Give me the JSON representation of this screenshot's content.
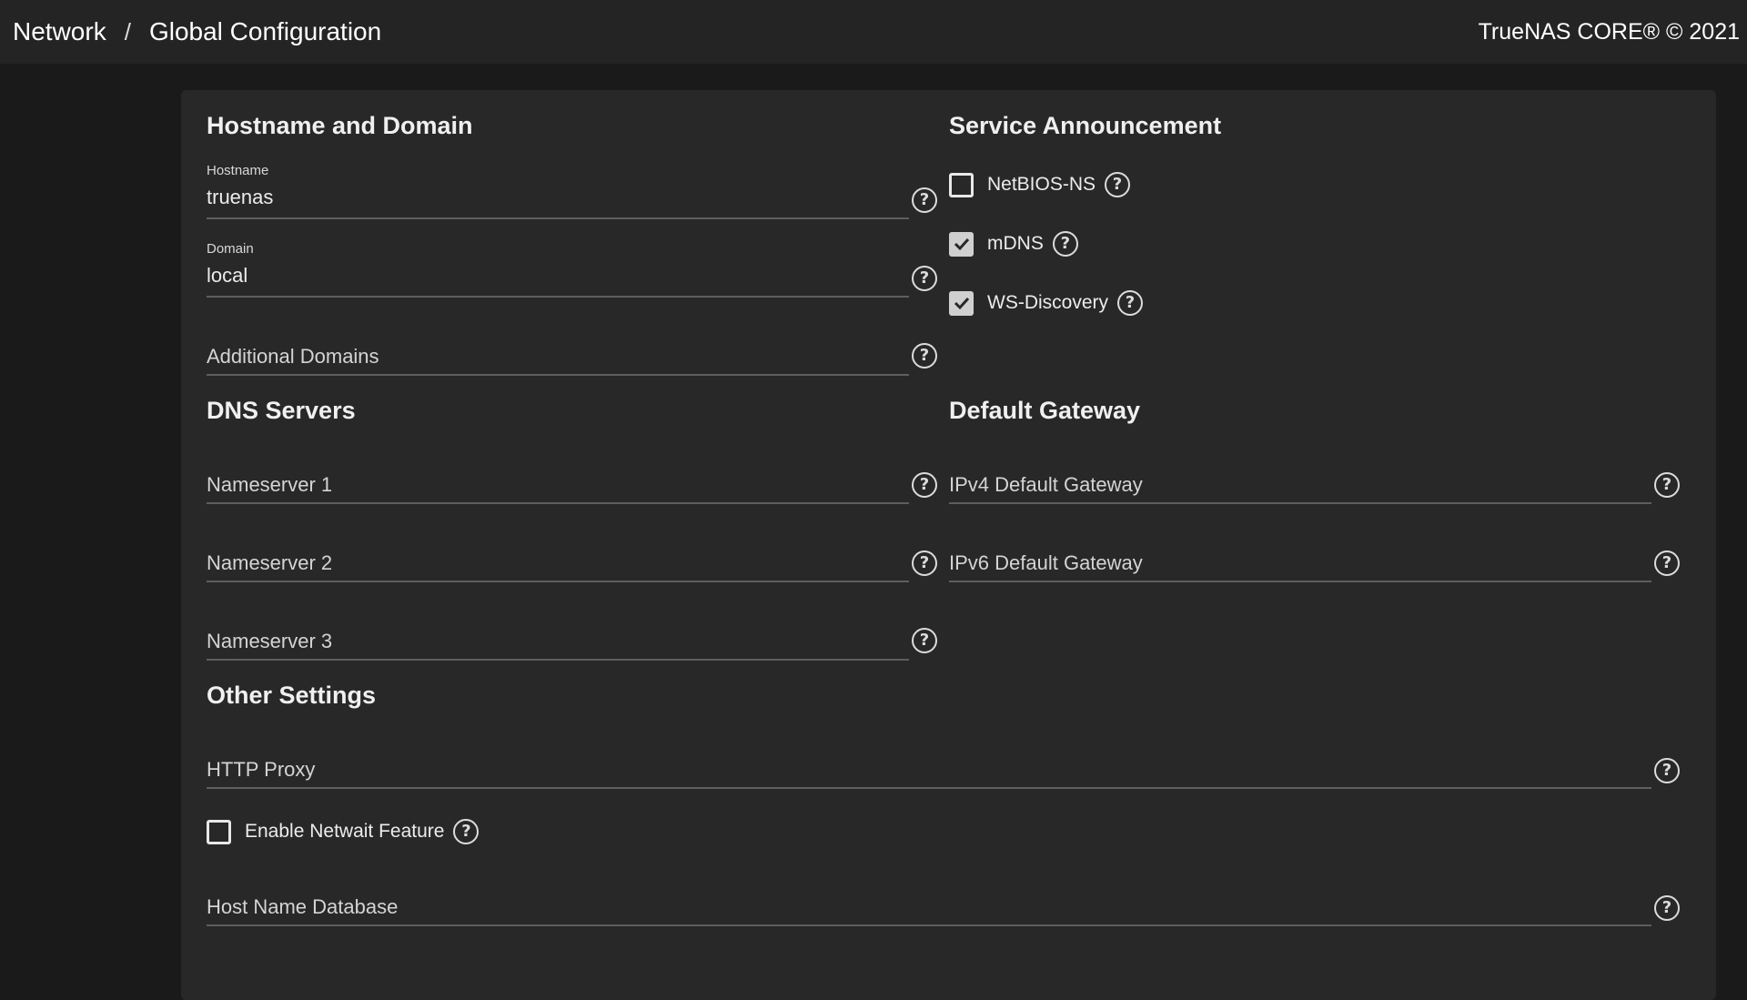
{
  "header": {
    "breadcrumb": [
      "Network",
      "Global Configuration"
    ],
    "separator": "/",
    "copyright": "TrueNAS CORE® © 2021"
  },
  "sections": {
    "hostname_domain": {
      "title": "Hostname and Domain",
      "hostname": {
        "label": "Hostname",
        "value": "truenas"
      },
      "domain": {
        "label": "Domain",
        "value": "local"
      },
      "additional_domains": {
        "placeholder": "Additional Domains",
        "value": ""
      }
    },
    "service_announcement": {
      "title": "Service Announcement",
      "netbios": {
        "label": "NetBIOS-NS",
        "checked": false
      },
      "mdns": {
        "label": "mDNS",
        "checked": true
      },
      "wsd": {
        "label": "WS-Discovery",
        "checked": true
      }
    },
    "dns_servers": {
      "title": "DNS Servers",
      "ns1": {
        "placeholder": "Nameserver 1",
        "value": ""
      },
      "ns2": {
        "placeholder": "Nameserver 2",
        "value": ""
      },
      "ns3": {
        "placeholder": "Nameserver 3",
        "value": ""
      }
    },
    "default_gateway": {
      "title": "Default Gateway",
      "ipv4": {
        "placeholder": "IPv4 Default Gateway",
        "value": ""
      },
      "ipv6": {
        "placeholder": "IPv6 Default Gateway",
        "value": ""
      }
    },
    "other_settings": {
      "title": "Other Settings",
      "http_proxy": {
        "placeholder": "HTTP Proxy",
        "value": ""
      },
      "netwait": {
        "label": "Enable Netwait Feature",
        "checked": false
      },
      "host_name_db": {
        "placeholder": "Host Name Database",
        "value": ""
      }
    }
  },
  "help_glyph": "?",
  "colors": {
    "background": "#1a1a1a",
    "card": "#282828",
    "topbar": "#242424",
    "checked": "#d0d0d0"
  }
}
